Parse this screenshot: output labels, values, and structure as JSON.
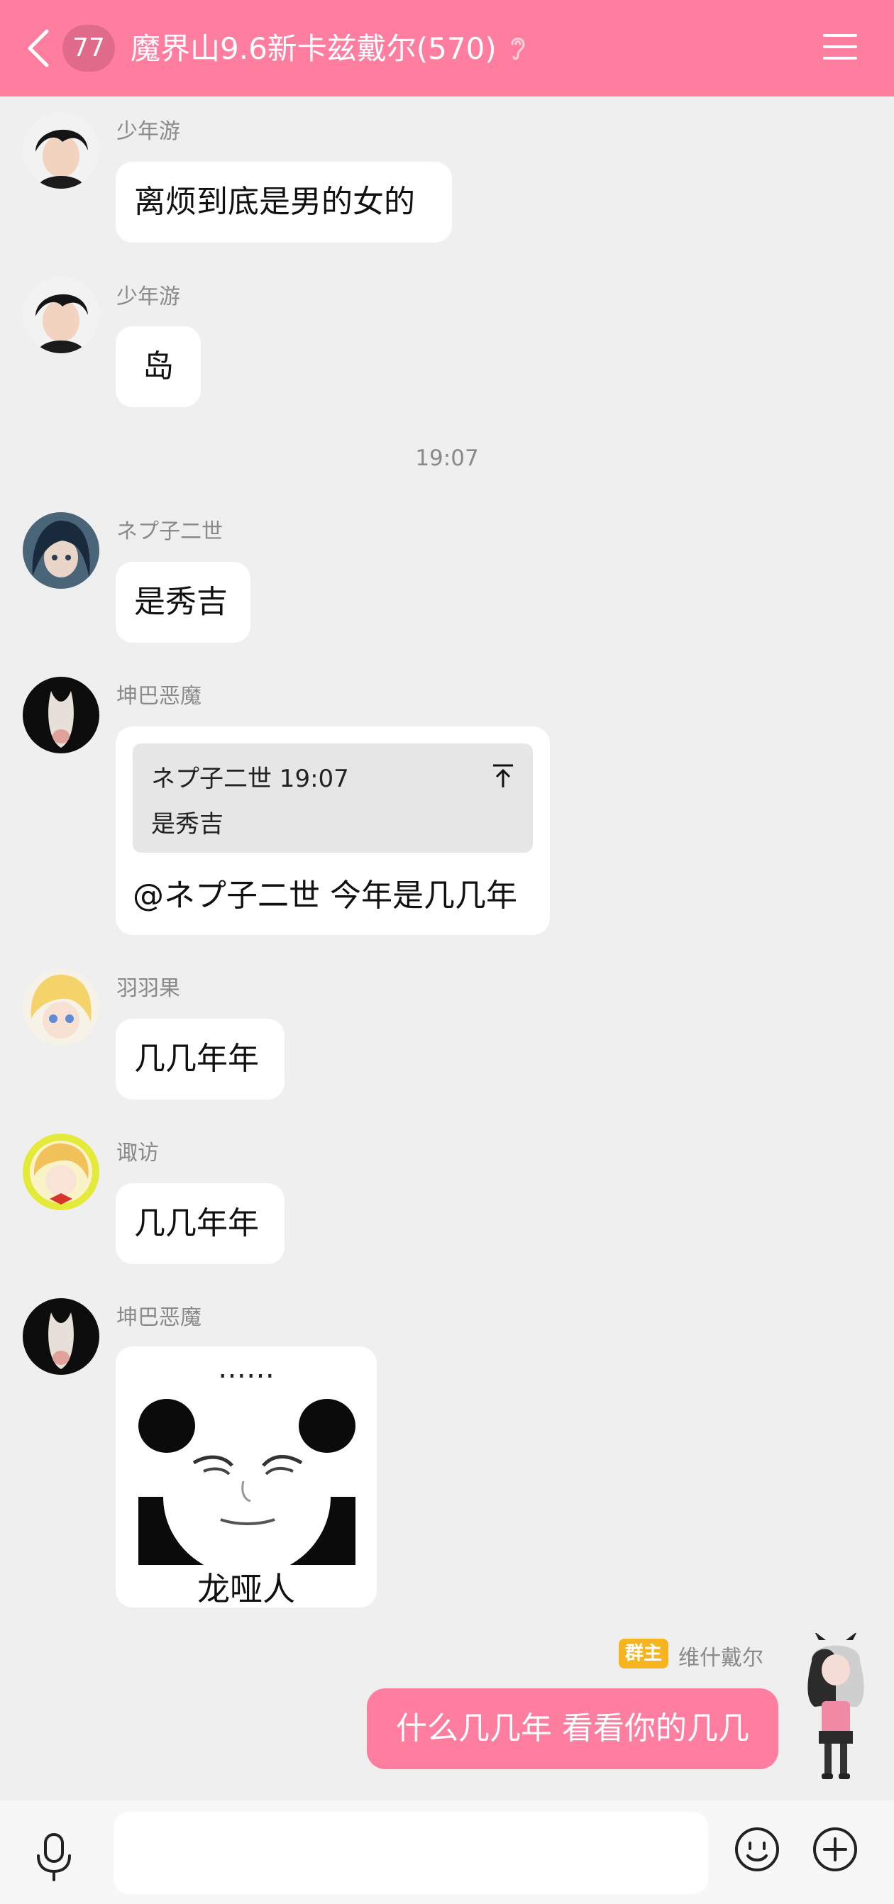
{
  "header": {
    "unread_count": "77",
    "title": "魔界山9.6新卡兹戴尔(570)"
  },
  "messages": [
    {
      "sender": "少年游",
      "text": "离烦到底是男的女的"
    },
    {
      "sender": "少年游",
      "text": "岛"
    },
    {
      "sender": "ネプ子二世",
      "text": "是秀吉"
    },
    {
      "sender": "坤巴恶魔",
      "quote_meta": "ネプ子二世 19:07",
      "quote_text": "是秀吉",
      "text": "@ネプ子二世 今年是几几年"
    },
    {
      "sender": "羽羽果",
      "text": "几几年年"
    },
    {
      "sender": "诹访",
      "text": "几几年年"
    },
    {
      "sender": "坤巴恶魔",
      "sticker_top": "……",
      "sticker_caption": "龙哑人"
    }
  ],
  "time_divider": "19:07",
  "self_message": {
    "badge": "群主",
    "sender": "维什戴尔",
    "text": "什么几几年 看看你的几几"
  },
  "input": {
    "placeholder": ""
  },
  "colors": {
    "accent": "#ff7ea0",
    "badge": "#f6b51f",
    "background": "#efeff0"
  }
}
